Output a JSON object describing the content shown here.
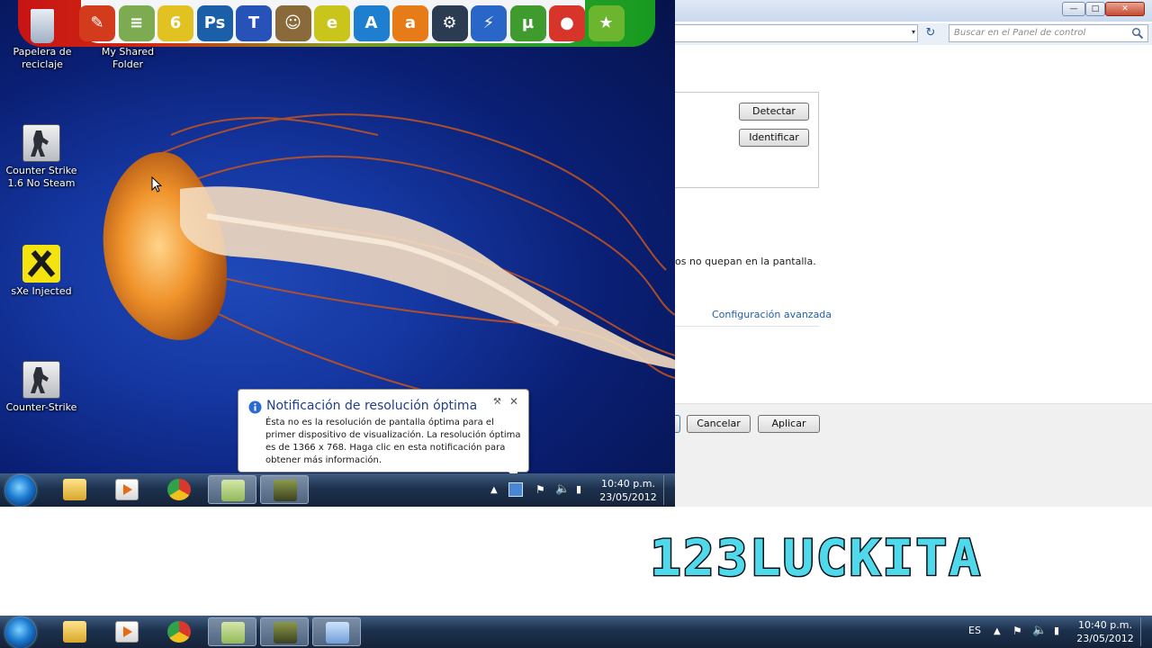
{
  "control_panel": {
    "window_buttons": {
      "minimize": "—",
      "maximize": "□",
      "close": "✕"
    },
    "address_dropdown": "▾",
    "search_placeholder": "Buscar en el Panel de control",
    "buttons": {
      "detect": "Detectar",
      "identify": "Identificar",
      "cancel": "Cancelar",
      "apply": "Aplicar"
    },
    "text_fragment": "os no quepan en la pantalla.",
    "advanced_link": "Configuración avanzada"
  },
  "desktop": {
    "quick_launch": [
      {
        "name": "ccleaner",
        "color": "#d23b1c",
        "glyph": "✎"
      },
      {
        "name": "winrar",
        "color": "#7cab52",
        "glyph": "≡"
      },
      {
        "name": "pes6",
        "color": "#e2c220",
        "glyph": "6"
      },
      {
        "name": "photoshop",
        "color": "#1b5fa8",
        "glyph": "Ps"
      },
      {
        "name": "fonts",
        "color": "#2752b8",
        "glyph": "T"
      },
      {
        "name": "game-character",
        "color": "#8a6a3a",
        "glyph": "☺"
      },
      {
        "name": "gear-e",
        "color": "#c9c51a",
        "glyph": "e"
      },
      {
        "name": "alcohol",
        "color": "#1e7fd1",
        "glyph": "A"
      },
      {
        "name": "avast",
        "color": "#e77b18",
        "glyph": "a"
      },
      {
        "name": "steam",
        "color": "#2b3b52",
        "glyph": "⚙"
      },
      {
        "name": "daemon-tools",
        "color": "#2a66c8",
        "glyph": "⚡"
      },
      {
        "name": "utorrent",
        "color": "#3f9b2e",
        "glyph": "µ"
      },
      {
        "name": "chrome",
        "color": "#d7352a",
        "glyph": "●"
      },
      {
        "name": "bookmark",
        "color": "#6bb52f",
        "glyph": "★"
      }
    ],
    "icons": [
      {
        "label": "Papelera de reciclaje",
        "name": "recycle-bin"
      },
      {
        "label": "My Shared Folder",
        "name": "my-shared-folder"
      },
      {
        "label": "Counter Strike 1.6 No Steam",
        "name": "counter-strike-16-no-steam"
      },
      {
        "label": "sXe Injected",
        "name": "sxe-injected"
      },
      {
        "label": "Counter-Strike",
        "name": "counter-strike"
      }
    ],
    "notification": {
      "title": "Notificación de resolución óptima",
      "body": "Ésta no es la resolución de pantalla óptima para el primer dispositivo de visualización. La resolución óptima es de 1366 x 768. Haga clic en esta notificación para obtener más información.",
      "close": "✕",
      "pin": "⚒"
    },
    "taskbar": {
      "time": "10:40 p.m.",
      "date": "23/05/2012"
    }
  },
  "outer_taskbar": {
    "language": "ES",
    "time": "10:40 p.m.",
    "date": "23/05/2012"
  },
  "watermark": "123LUCKITA",
  "colors": {
    "accent_link": "#1f5fae",
    "watermark": "#4fd9ea"
  }
}
